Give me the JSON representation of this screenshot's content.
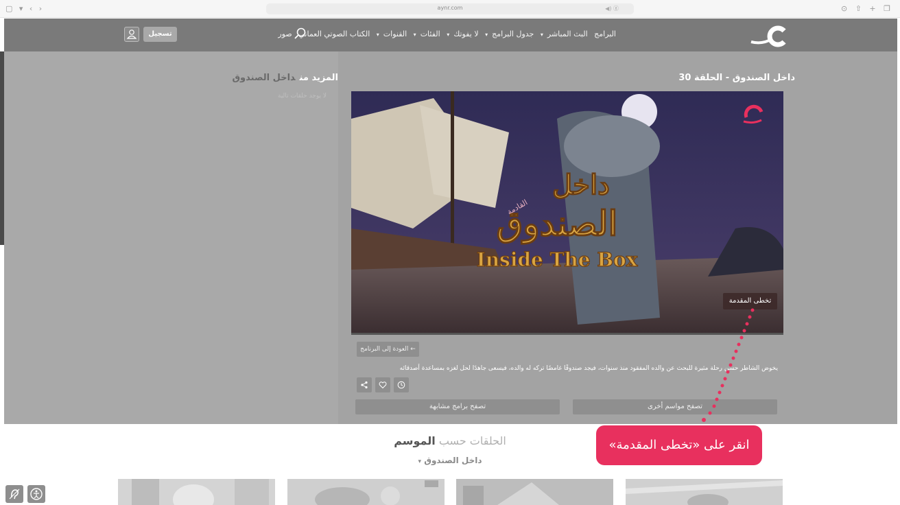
{
  "browser": {
    "url": "aynr.com",
    "extra": "◀) ⓖ"
  },
  "header": {
    "nav_items": [
      "البرامج",
      "البث المباشر",
      "جدول البرامج",
      "لا يفوتك",
      "الفئات",
      "القنوات",
      "الكتاب الصوتي العماني",
      "صور"
    ],
    "register_label": "تسجيل"
  },
  "sidebar": {
    "more_prefix": "المزيد من",
    "more_show": "داخل الصندوق",
    "no_episodes": "لا يوجد حلقات تالية"
  },
  "main": {
    "episode_title": "داخل الصندوق - الحلقة 30",
    "skip_intro": "تخطى المقدمة",
    "back_label": "العودة إلى البرنامج ←",
    "description": "يخوض الشاطر حسن رحلة مثيرة للبحث عن والده المفقود منذ سنوات، فيجد صندوقًا غامضًا تركه له والده، فيسعى جاهدًا لحل لغزه بمساعدة أصدقائه",
    "browse_seasons": "تصفح مواسم أخرى",
    "browse_similar": "تصفح برامج مشابهة"
  },
  "player": {
    "title_ar_1": "داخل",
    "title_ar_2": "الصندوق",
    "title_en": "Inside The Box",
    "subtitle_ar": "القادمة"
  },
  "seasons": {
    "title_prefix": "الحلقات حسب",
    "title_bold": "الموسم",
    "selected": "داخل الصندوق"
  },
  "tooltip": {
    "text": "انقر على «تخطى المقدمة»"
  },
  "colors": {
    "accent": "#e8305e",
    "header_bg": "#7a7a7a"
  }
}
